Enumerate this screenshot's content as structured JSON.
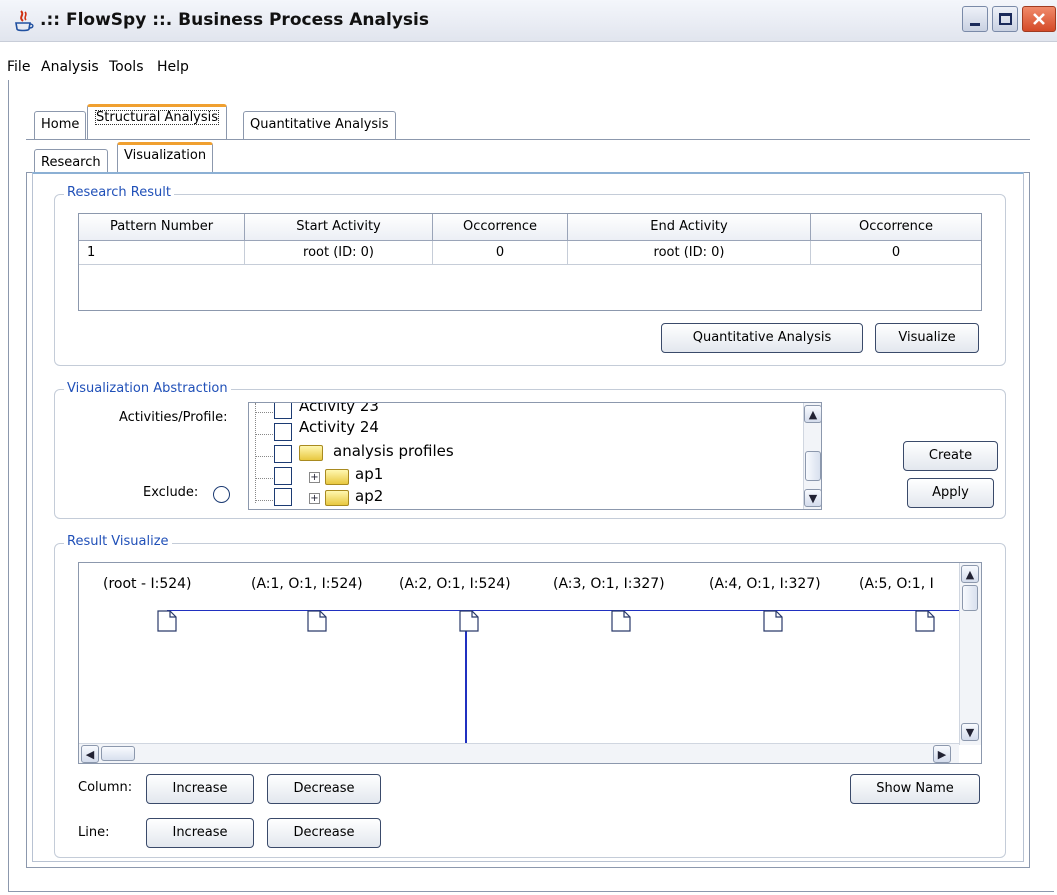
{
  "window": {
    "title": ".:: FlowSpy ::. Business Process Analysis",
    "minimize_label": "_",
    "maximize_label": "□",
    "close_label": "X"
  },
  "menu": [
    "File",
    "Analysis",
    "Tools",
    "Help"
  ],
  "main_tabs": [
    "Home",
    "Structural Analysis",
    "Quantitative Analysis"
  ],
  "main_tab_active": "Structural Analysis",
  "sub_tabs": [
    "Research",
    "Visualization"
  ],
  "sub_tab_active": "Visualization",
  "research_result": {
    "title": "Research Result",
    "columns": [
      "Pattern Number",
      "Start Activity",
      "Occorrence",
      "End Activity",
      "Occorrence"
    ],
    "rows": [
      [
        "1",
        "root (ID: 0)",
        "0",
        "root (ID: 0)",
        "0"
      ]
    ],
    "quantitative_button": "Quantitative Analysis",
    "visualize_button": "Visualize"
  },
  "visualization_abstraction": {
    "title": "Visualization Abstraction",
    "activities_label": "Activities/Profile:",
    "exclude_label": "Exclude:",
    "tree_items": [
      "Activity 23",
      "Activity 24",
      "analysis profiles",
      "ap1",
      "ap2"
    ],
    "create_button": "Create",
    "apply_button": "Apply"
  },
  "result_visualize": {
    "title": "Result Visualize",
    "nodes": [
      "(root - I:524)",
      "(A:1, O:1, I:524)",
      "(A:2, O:1, I:524)",
      "(A:3, O:1, I:327)",
      "(A:4, O:1, I:327)",
      "(A:5, O:1, I"
    ],
    "column_label": "Column:",
    "line_label": "Line:",
    "increase_label": "Increase",
    "decrease_label": "Decrease",
    "show_name_button": "Show Name"
  },
  "colors": {
    "group_title": "#2050b8",
    "tab_accent": "#f0a030",
    "connector_line": "#2030c0"
  }
}
